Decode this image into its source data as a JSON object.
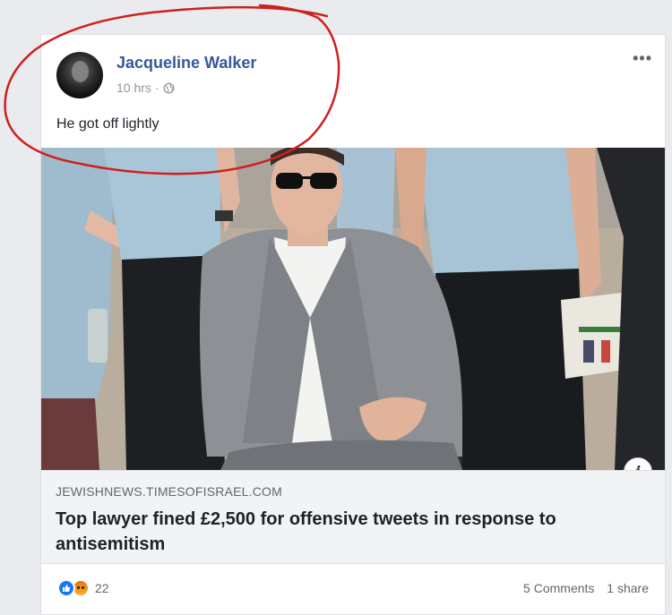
{
  "post": {
    "author_name": "Jacqueline Walker",
    "timestamp": "10 hrs",
    "separator": "·",
    "privacy_icon": "globe-icon",
    "more_menu": "•••",
    "text": "He got off lightly"
  },
  "link_preview": {
    "info_button": "i",
    "domain": "JEWISHNEWS.TIMESOFISRAEL.COM",
    "headline": "Top lawyer fined £2,500 for offensive tweets in response to antisemitism"
  },
  "footer": {
    "reaction_icons": [
      "like-icon",
      "angry-icon"
    ],
    "reaction_count": "22",
    "comments": "5 Comments",
    "shares": "1 share"
  },
  "colors": {
    "author_link": "#385898",
    "annotation_circle": "#d0201c",
    "like_blue": "#1877f2"
  }
}
